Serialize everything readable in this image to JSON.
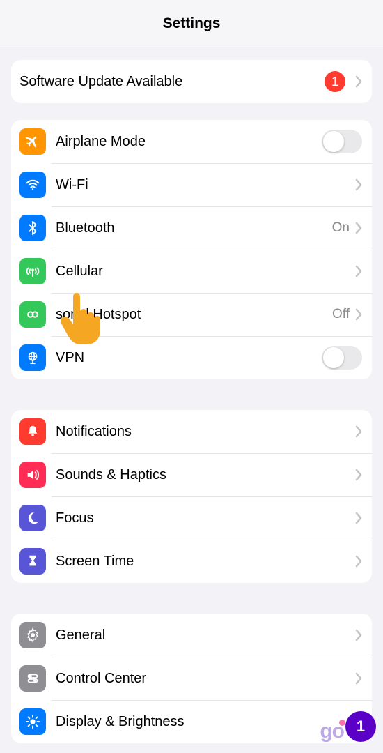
{
  "header": {
    "title": "Settings"
  },
  "software_update": {
    "label": "Software Update Available",
    "badge": "1"
  },
  "connectivity": {
    "airplane": {
      "label": "Airplane Mode",
      "icon_color": "#ff9500"
    },
    "wifi": {
      "label": "Wi-Fi",
      "icon_color": "#007aff"
    },
    "bluetooth": {
      "label": "Bluetooth",
      "value": "On",
      "icon_color": "#007aff"
    },
    "cellular": {
      "label": "Cellular",
      "icon_color": "#34c759"
    },
    "hotspot": {
      "label": "sonal Hotspot",
      "value": "Off",
      "icon_color": "#34c759"
    },
    "vpn": {
      "label": "VPN",
      "icon_color": "#007aff"
    }
  },
  "notifications_group": {
    "notifications": {
      "label": "Notifications",
      "icon_color": "#ff3b30"
    },
    "sounds": {
      "label": "Sounds & Haptics",
      "icon_color": "#ff2d55"
    },
    "focus": {
      "label": "Focus",
      "icon_color": "#5856d6"
    },
    "screentime": {
      "label": "Screen Time",
      "icon_color": "#5856d6"
    }
  },
  "general_group": {
    "general": {
      "label": "General",
      "icon_color": "#8e8e93"
    },
    "control": {
      "label": "Control Center",
      "icon_color": "#8e8e93"
    },
    "display": {
      "label": "Display & Brightness",
      "icon_color": "#007aff"
    }
  },
  "corner": {
    "logo_text": "go",
    "badge": "1"
  }
}
